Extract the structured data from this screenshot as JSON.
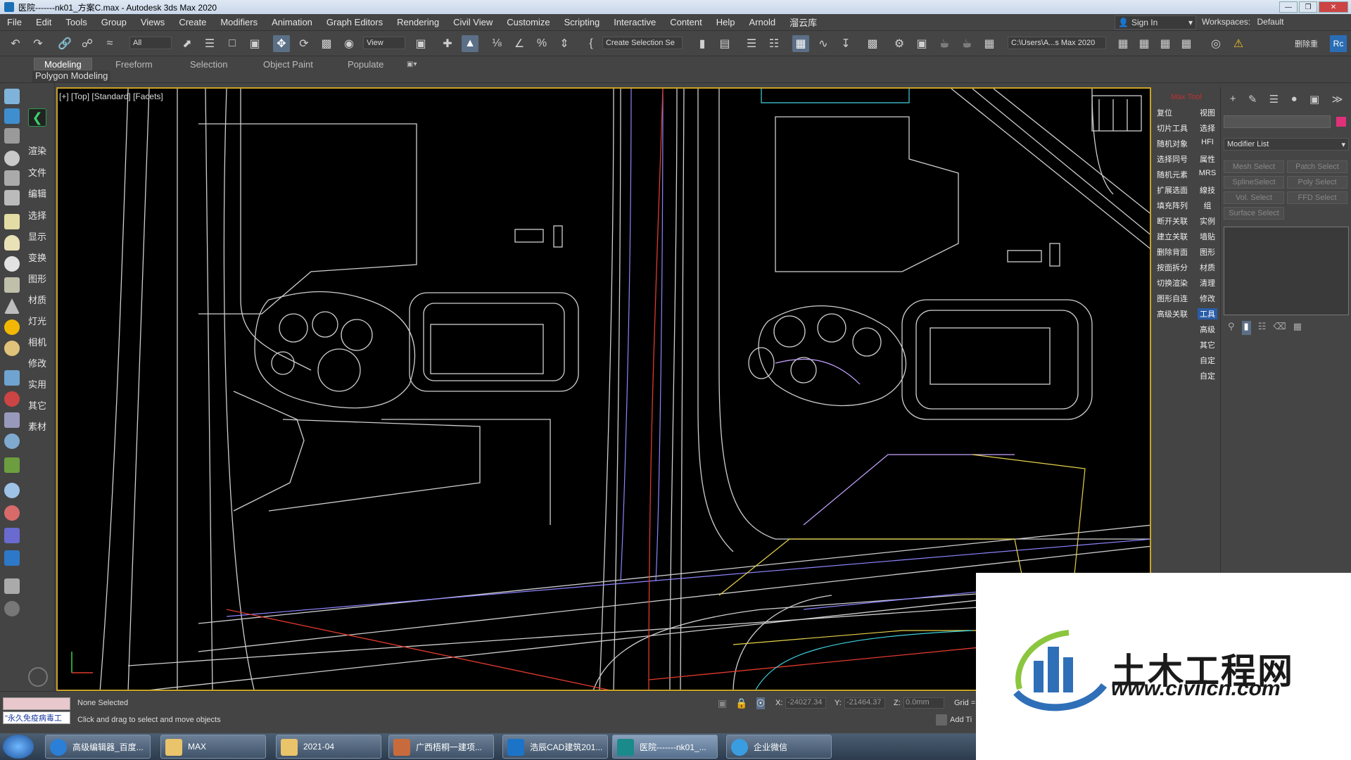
{
  "window": {
    "title": "医院-------nk01_方案C.max - Autodesk 3ds Max 2020"
  },
  "menu": {
    "items": [
      "File",
      "Edit",
      "Tools",
      "Group",
      "Views",
      "Create",
      "Modifiers",
      "Animation",
      "Graph Editors",
      "Rendering",
      "Civil View",
      "Customize",
      "Scripting",
      "Interactive",
      "Content",
      "Help",
      "Arnold",
      "溜云库"
    ],
    "sign_in": "Sign In",
    "workspaces_label": "Workspaces:",
    "workspaces_value": "Default"
  },
  "toolbar": {
    "filter_value": "All",
    "ref_coord_value": "View",
    "selection_set": "Create Selection Se",
    "path_value": "C:\\Users\\A...s Max 2020",
    "right_label": "删除重"
  },
  "ribbon": {
    "tabs": [
      "Modeling",
      "Freeform",
      "Selection",
      "Object Paint",
      "Populate"
    ],
    "sub_label": "Polygon Modeling"
  },
  "left_panel": {
    "items": [
      "渲染",
      "文件",
      "编辑",
      "选择",
      "显示",
      "变换",
      "图形",
      "材质",
      "灯光",
      "相机",
      "修改",
      "实用",
      "其它",
      "素材"
    ]
  },
  "viewport": {
    "label": "[+] [Top] [Standard] [Facets]"
  },
  "right_tools": {
    "header": "Max Tool",
    "rows": [
      [
        "复位",
        "视图"
      ],
      [
        "切片工具",
        "选择"
      ],
      [
        "随机对象",
        "HFI"
      ],
      [
        "选择同号",
        "属性"
      ],
      [
        "随机元素",
        "MRS"
      ],
      [
        "扩展选面",
        "線技"
      ],
      [
        "填充阵列",
        "组"
      ],
      [
        "断开关联",
        "实例"
      ],
      [
        "建立关联",
        "墙贴"
      ],
      [
        "删除背面",
        "图形"
      ],
      [
        "按面拆分",
        "材质"
      ],
      [
        "切换渲染",
        "清理"
      ],
      [
        "图形自连",
        "修改"
      ],
      [
        "高级关联",
        "工具"
      ],
      [
        "",
        "高级"
      ],
      [
        "",
        "其它"
      ],
      [
        "",
        "自定"
      ],
      [
        "",
        "自定"
      ]
    ]
  },
  "command_panel": {
    "modifier_list": "Modifier List",
    "buttons": [
      "Mesh Select",
      "Patch Select",
      "SplineSelect",
      "Poly Select",
      "Vol. Select",
      "FFD Select",
      "Surface Select"
    ],
    "color_swatch": "#e0307a"
  },
  "status": {
    "selection": "None Selected",
    "prompt": "Click and drag to select and move objects",
    "maxscript_text": "\"永久免疫病毒工",
    "x_label": "X:",
    "x_value": "-24027.34",
    "y_label": "Y:",
    "y_value": "-21464.37",
    "z_label": "Z:",
    "z_value": "0.0mm",
    "grid_label": "Grid =",
    "add_time_tag": "Add Ti"
  },
  "taskbar": {
    "tasks": [
      "高级编辑器_百度...",
      "MAX",
      "2021-04",
      "广西梧桐一建项...",
      "浩辰CAD建筑201...",
      "医院-------nk01_...",
      "企业微信"
    ]
  },
  "watermark": {
    "title": "土木工程网",
    "url": "www.civilcn.com"
  },
  "colors": {
    "accent": "#5b6f86",
    "viewport_border": "#c9a227",
    "highlight": "#2a5da8"
  }
}
